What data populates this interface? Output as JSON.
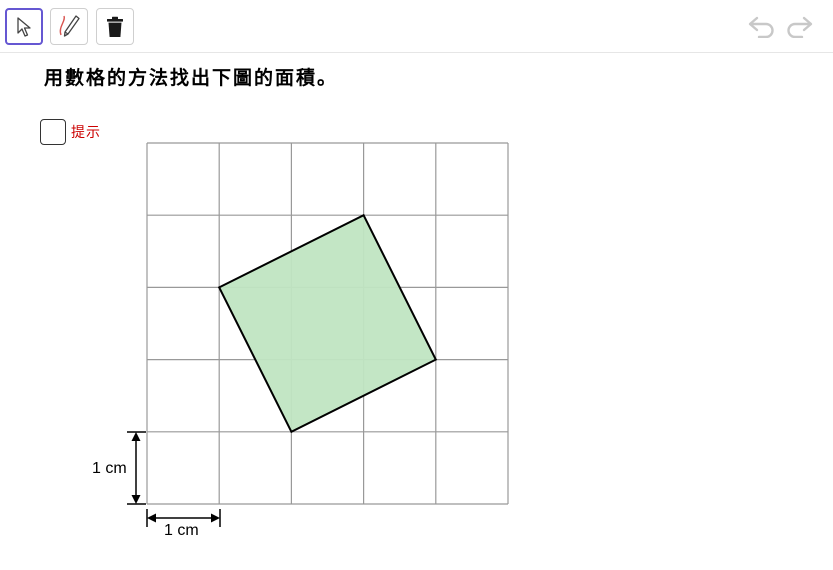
{
  "toolbar": {
    "tools": [
      {
        "name": "move",
        "icon": "cursor-arrow-icon",
        "active": true
      },
      {
        "name": "pen",
        "icon": "pen-icon",
        "active": false
      },
      {
        "name": "delete",
        "icon": "trash-icon",
        "active": false
      }
    ],
    "undo_icon": "undo-icon",
    "redo_icon": "redo-icon"
  },
  "question": {
    "text": "用數格的方法找出下圖的面積。"
  },
  "hint": {
    "label": "提示",
    "checked": false
  },
  "figure": {
    "grid_columns": 5,
    "grid_rows": 5,
    "square_vertices": [
      [
        1,
        3
      ],
      [
        3,
        4
      ],
      [
        4,
        2
      ],
      [
        2,
        1
      ]
    ],
    "fill_color": "#c0e5c2",
    "stroke_color": "#000000",
    "grid_color": "#999999",
    "vertical_dimension_label": "1 cm",
    "horizontal_dimension_label": "1 cm"
  },
  "colors": {
    "active_tool_border": "#6557d2",
    "hint_text": "#cc0000",
    "history_icons": "#c8c8c8"
  }
}
